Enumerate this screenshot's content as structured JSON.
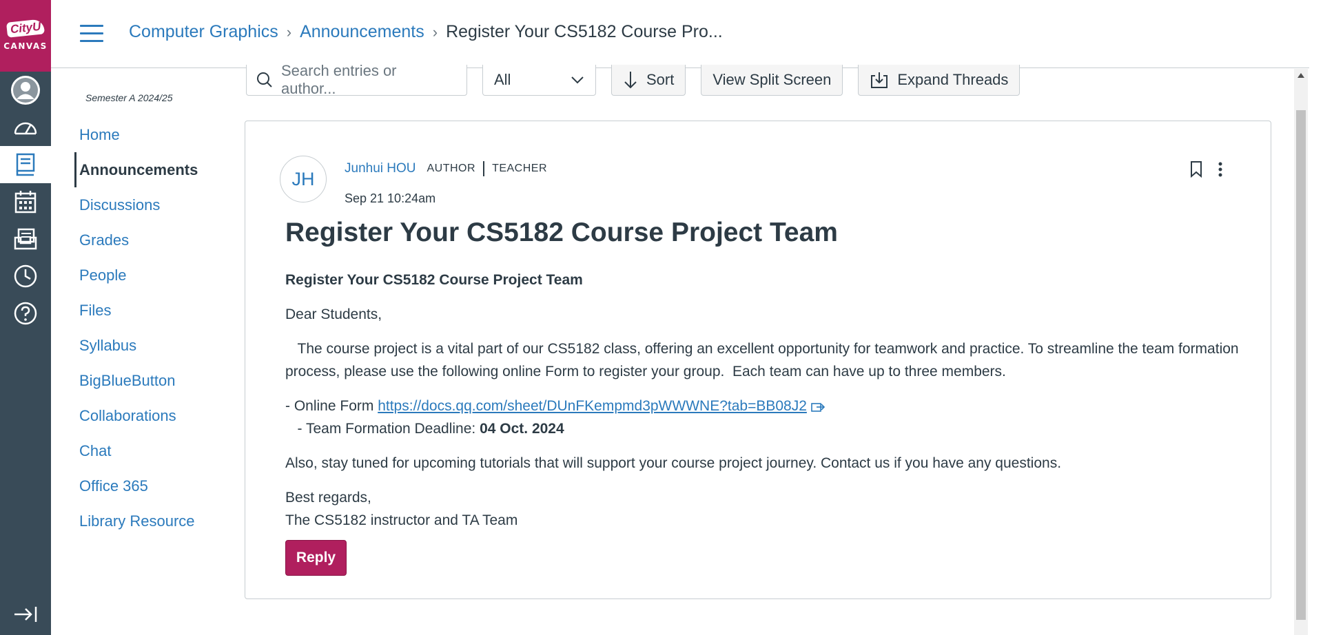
{
  "brand": {
    "logo_top": "CityU",
    "logo_bottom": "CANVAS"
  },
  "global_nav": [
    {
      "icon": "account-icon",
      "label": "Account"
    },
    {
      "icon": "dashboard-icon",
      "label": "Dashboard"
    },
    {
      "icon": "courses-icon",
      "label": "Courses",
      "active": true
    },
    {
      "icon": "calendar-icon",
      "label": "Calendar"
    },
    {
      "icon": "inbox-icon",
      "label": "Inbox"
    },
    {
      "icon": "history-icon",
      "label": "History"
    },
    {
      "icon": "help-icon",
      "label": "Help"
    }
  ],
  "breadcrumb": {
    "course": "Computer Graphics",
    "section": "Announcements",
    "current": "Register Your CS5182 Course Pro..."
  },
  "course_nav": {
    "term": "Semester A 2024/25",
    "items": [
      "Home",
      "Announcements",
      "Discussions",
      "Grades",
      "People",
      "Files",
      "Syllabus",
      "BigBlueButton",
      "Collaborations",
      "Chat",
      "Office 365",
      "Library Resource"
    ],
    "active": "Announcements"
  },
  "toolbar": {
    "search_placeholder": "Search entries or author...",
    "filter_value": "All",
    "sort_label": "Sort",
    "split_label": "View Split Screen",
    "expand_label": "Expand Threads"
  },
  "post": {
    "avatar_initials": "JH",
    "author": "Junhui HOU",
    "role_author": "AUTHOR",
    "role_teacher": "TEACHER",
    "date": "Sep 21 10:24am",
    "title": "Register Your CS5182 Course Project Team",
    "subtitle": "Register Your CS5182 Course Project Team",
    "greeting": "Dear Students,",
    "paragraph": "   The course project is a vital part of our CS5182 class, offering an excellent opportunity for teamwork and practice. To streamline the team formation process, please use the following online Form to register your group.  Each team can have up to three members.",
    "form_prefix": "- Online Form ",
    "form_link": "https://docs.qq.com/sheet/DUnFKempmd3pWWWNE?tab=BB08J2",
    "deadline_prefix": "   - Team Formation Deadline: ",
    "deadline_value": "04 Oct. 2024",
    "closing_line": "Also, stay tuned for upcoming tutorials that will support your course project journey. Contact us if you have any questions.",
    "regards": "Best regards,",
    "signature": "The CS5182 instructor and TA Team",
    "reply_label": "Reply"
  }
}
